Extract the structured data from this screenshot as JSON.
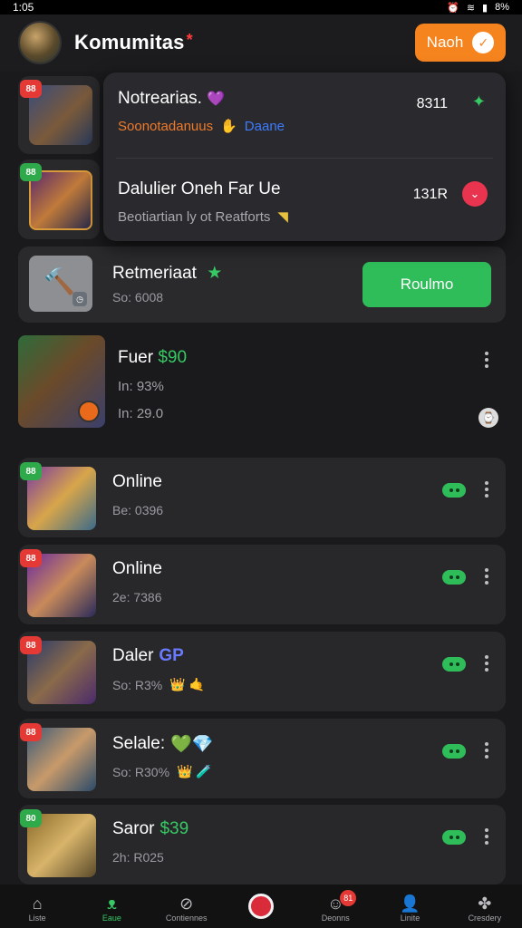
{
  "status_bar": {
    "time": "1:05",
    "battery": "8%"
  },
  "header": {
    "title": "Komumitas",
    "title_star": "*",
    "action_label": "Naoh",
    "action_icon": "✓"
  },
  "side_badges": [
    "88",
    "88"
  ],
  "popup": {
    "item1": {
      "title": "Notrearias.",
      "title_emoji": "💜",
      "sub": "Soonotadanuus",
      "sub_extra": "Daane",
      "number": "8311"
    },
    "item2": {
      "title": "Dalulier Oneh Far Ue",
      "sub": "Beotiartian ly ot Reatforts",
      "number": "131R"
    }
  },
  "promo": {
    "title": "Retmeriaat",
    "title_icon": "★",
    "sub": "So: 6008",
    "button": "Roulmo"
  },
  "feature": {
    "title_main": "Fuer",
    "title_accent": "$90",
    "line1": "In: 93%",
    "line2": "In: 29.0",
    "accent_color": "#36c964"
  },
  "list": [
    {
      "badge": "88",
      "badge_color": "green",
      "title": "Online",
      "title_extra": "",
      "sub": "Be: 0396",
      "sub_icons": ""
    },
    {
      "badge": "88",
      "badge_color": "red",
      "title": "Online",
      "title_extra": "",
      "sub": "2e: 7386",
      "sub_icons": ""
    },
    {
      "badge": "88",
      "badge_color": "red",
      "title": "Daler",
      "title_extra": "GP",
      "sub": "So: R3%",
      "sub_icons": "👑 🤙"
    },
    {
      "badge": "88",
      "badge_color": "red",
      "title": "Selale:",
      "title_extra": "💚💎",
      "sub": "So: R30%",
      "sub_icons": "👑 🧪"
    },
    {
      "badge": "80",
      "badge_color": "green",
      "title": "Saror",
      "title_extra": "$39",
      "sub": "2h: R025",
      "sub_icons": ""
    }
  ],
  "bottom_nav": [
    {
      "label": "Liste",
      "icon": "⌂"
    },
    {
      "label": "Eaue",
      "icon": "ᴥ"
    },
    {
      "label": "Contiennes",
      "icon": "⊘"
    },
    {
      "label": "",
      "icon": ""
    },
    {
      "label": "Deonns",
      "icon": "☺",
      "badge": "81"
    },
    {
      "label": "Linite",
      "icon": "👤"
    },
    {
      "label": "Cresdery",
      "icon": "✤"
    }
  ]
}
